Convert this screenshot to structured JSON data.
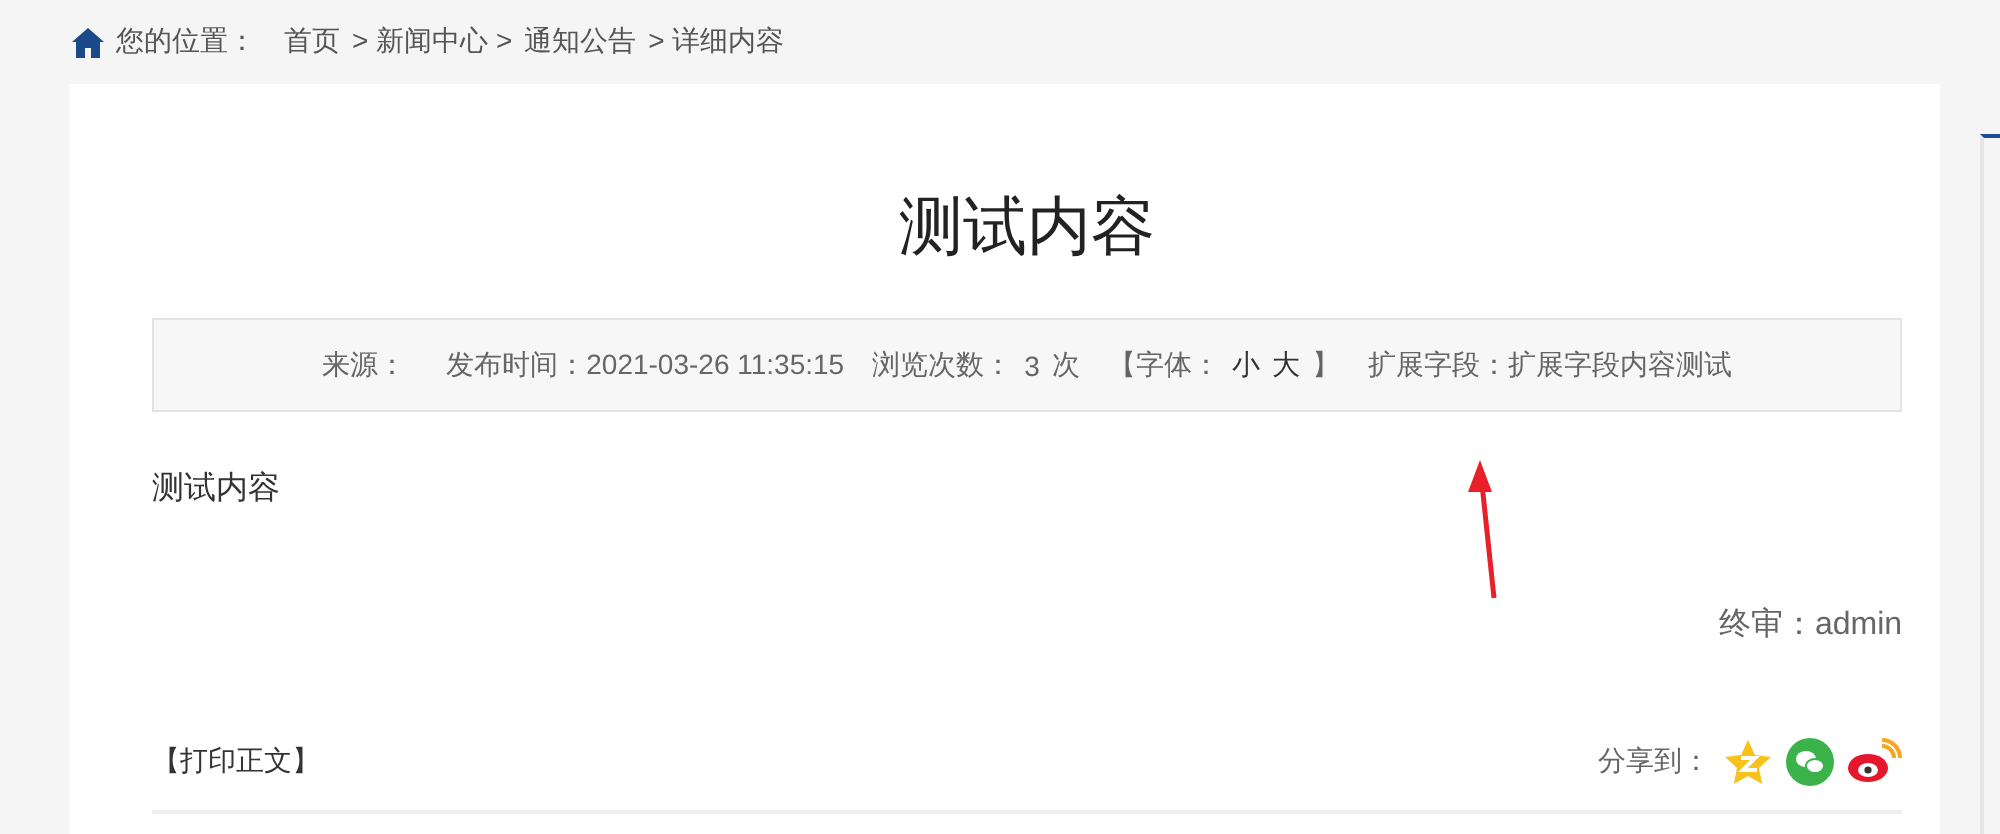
{
  "breadcrumb": {
    "label": "您的位置：",
    "items": [
      "首页",
      "> 新闻中心 >",
      "通知公告",
      "> 详细内容"
    ]
  },
  "article": {
    "title": "测试内容",
    "meta": {
      "source": "来源：",
      "published": "发布时间：2021-03-26 11:35:15",
      "views_label": "浏览次数：",
      "views": "3",
      "views_unit": "次",
      "font_open": "【字体：",
      "font_small": "小",
      "font_large": "大",
      "font_close": "】",
      "extra": "扩展字段：扩展字段内容测试"
    },
    "body": "测试内容",
    "reviewer": "终审：admin",
    "print": "【打印正文】",
    "share_label": "分享到："
  }
}
